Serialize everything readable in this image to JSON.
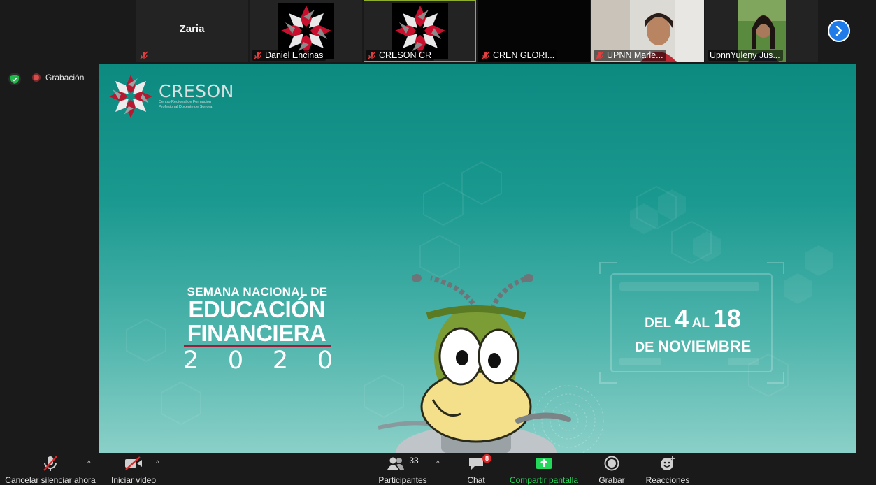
{
  "participants": [
    {
      "name": "Zaria",
      "kind": "name-only"
    },
    {
      "name": "Daniel Encinas",
      "kind": "logo"
    },
    {
      "name": "CRESON CR",
      "kind": "logo",
      "active": true
    },
    {
      "name": "CREN GLORI...",
      "kind": "dark"
    },
    {
      "name": "UPNN Marle...",
      "kind": "camera"
    },
    {
      "name": "UpnnYuleny Jus...",
      "kind": "camera"
    }
  ],
  "status": {
    "recording_label": "Grabación"
  },
  "slide": {
    "org_name": "CRESON",
    "org_subtitle_1": "Centro Regional de Formación",
    "org_subtitle_2": "Profesional Docente de Sonora",
    "event_line1": "SEMANA NACIONAL DE",
    "event_line2": "EDUCACIÓN",
    "event_line3": "FINANCIERA",
    "event_year": [
      "2",
      "0",
      "2",
      "0"
    ],
    "date_del": "DEL",
    "date_start": "4",
    "date_al": "AL",
    "date_end": "18",
    "date_de": "DE",
    "date_month": "NOVIEMBRE"
  },
  "toolbar": {
    "unmute_label": "Cancelar silenciar ahora",
    "video_label": "Iniciar video",
    "participants_label": "Participantes",
    "participants_count": "33",
    "chat_label": "Chat",
    "chat_badge": "8",
    "share_label": "Compartir pantalla",
    "record_label": "Grabar",
    "reactions_label": "Reacciones"
  },
  "colors": {
    "accent_green": "#23d959",
    "brand_red": "#9b1f3a",
    "slide_teal": "#0d8a80",
    "next_blue": "#1f7be8"
  }
}
